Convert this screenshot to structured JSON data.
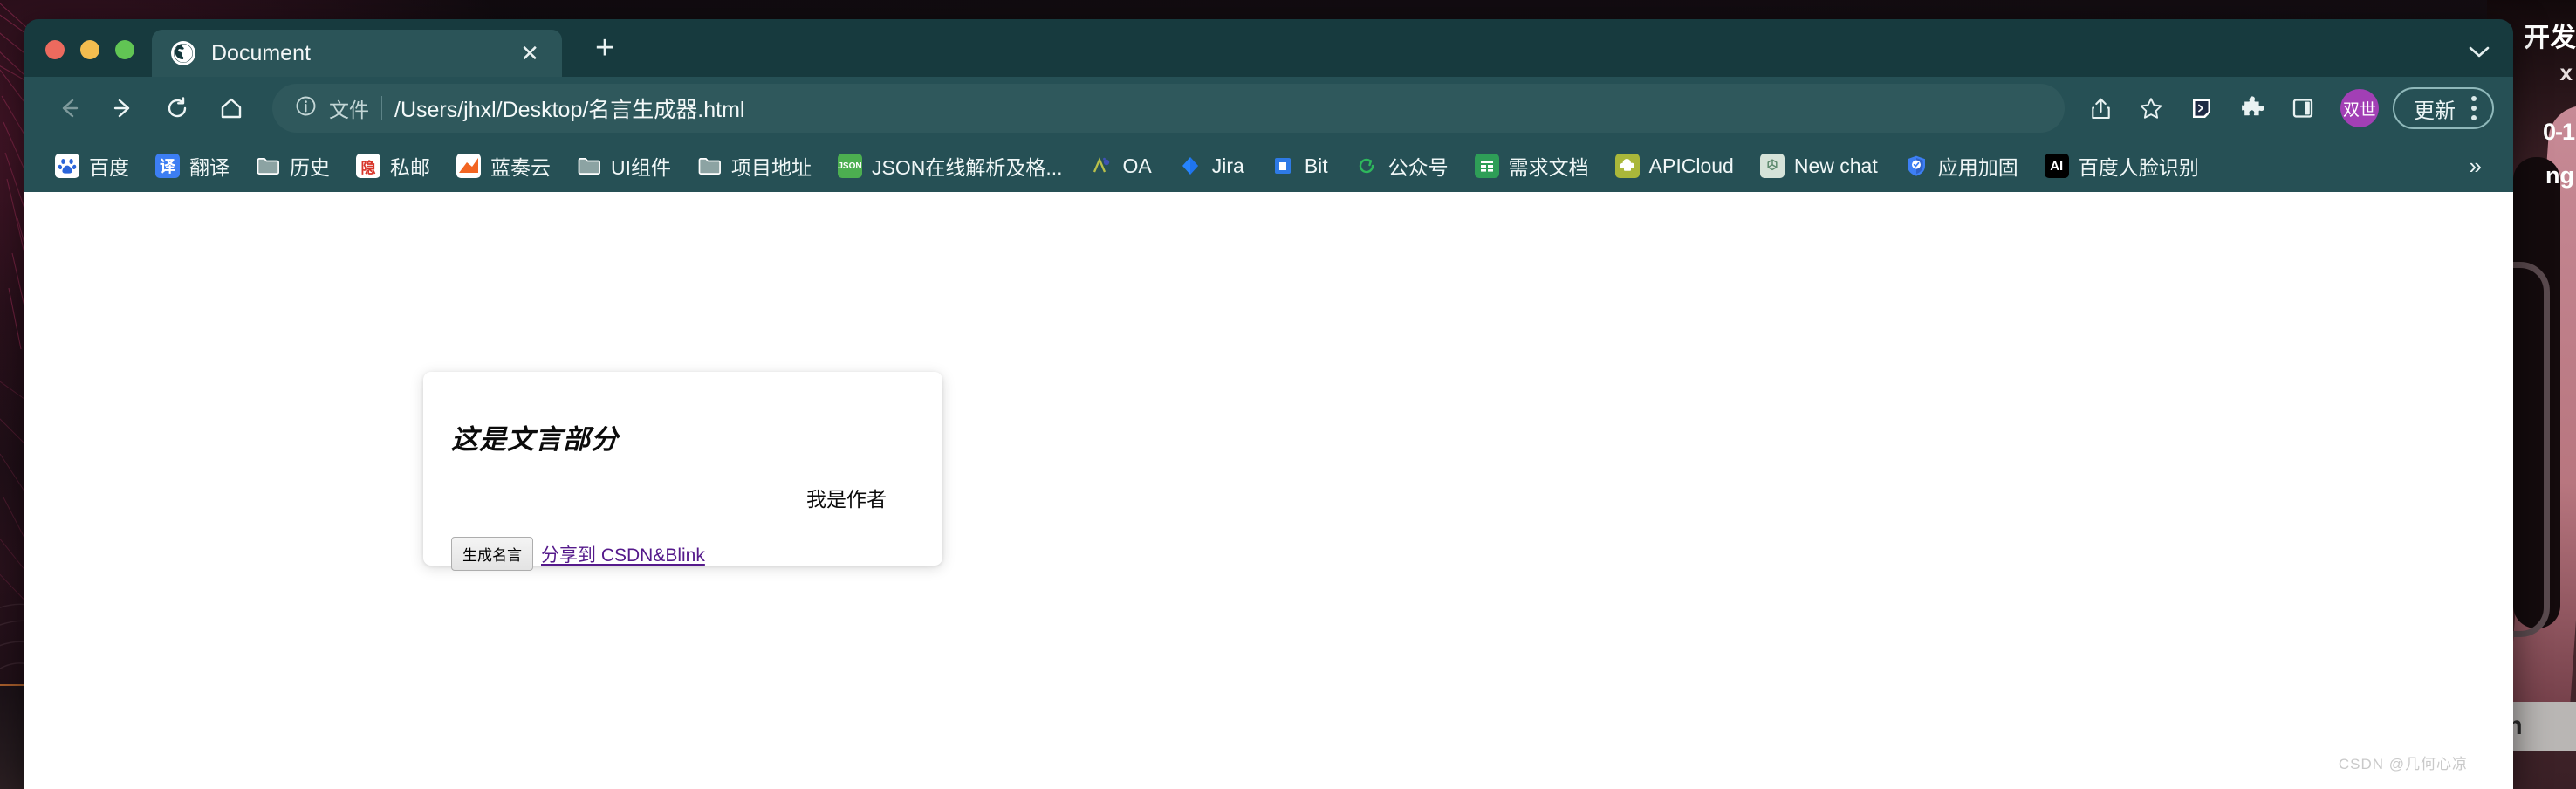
{
  "window": {
    "traffic_lights": [
      "close",
      "minimize",
      "maximize"
    ]
  },
  "tab": {
    "favicon": "globe-icon",
    "title": "Document",
    "close_label": "✕",
    "new_tab_label": "+",
    "tab_search_label": "∨"
  },
  "toolbar": {
    "back_label": "←",
    "forward_label": "→",
    "reload_label": "⟳",
    "home_label": "⌂",
    "omnibox": {
      "info_icon": "info-circle-icon",
      "scheme_label": "文件",
      "url": "/Users/jhxl/Desktop/名言生成器.html"
    },
    "share_label": "share-icon",
    "bookmark_star_label": "star-icon",
    "extension1_label": "devtools-extension-icon",
    "extension_puzzle_label": "puzzle-icon",
    "side_panel_label": "side-panel-icon",
    "avatar_label": "双世",
    "update_label": "更新",
    "menu_label": "kebab-menu-icon"
  },
  "bookmarks": {
    "items": [
      {
        "label": "百度",
        "icon": "baidu-paw-icon",
        "icon_text": "✿",
        "bg": "#ffffff",
        "fg": "#2b65d9"
      },
      {
        "label": "翻译",
        "icon": "translate-icon",
        "icon_text": "译",
        "bg": "#3c7ef3",
        "fg": "#ffffff"
      },
      {
        "label": "历史",
        "icon": "folder-icon",
        "icon_text": "",
        "bg": "folder",
        "fg": "#ffffff"
      },
      {
        "label": "私邮",
        "icon": "private-mail-icon",
        "icon_text": "隐",
        "bg": "#ffffff",
        "fg": "#d8352a"
      },
      {
        "label": "蓝奏云",
        "icon": "lanzou-cloud-icon",
        "icon_text": "◥",
        "bg": "#f26522",
        "fg": "#ffffff"
      },
      {
        "label": "UI组件",
        "icon": "folder-icon",
        "icon_text": "",
        "bg": "folder",
        "fg": "#ffffff"
      },
      {
        "label": "项目地址",
        "icon": "folder-icon",
        "icon_text": "",
        "bg": "folder",
        "fg": "#ffffff"
      },
      {
        "label": "JSON在线解析及格...",
        "icon": "json-icon",
        "icon_text": "{}",
        "bg": "#4caf50",
        "fg": "#ffffff"
      },
      {
        "label": "OA",
        "icon": "oa-icon",
        "icon_text": "A",
        "bg": "#d6d99a",
        "fg": "#3f51b5"
      },
      {
        "label": "Jira",
        "icon": "jira-icon",
        "icon_text": "◆",
        "bg": "transparent",
        "fg": "#2684ff"
      },
      {
        "label": "Bit",
        "icon": "bit-icon",
        "icon_text": "■",
        "bg": "#2e7ae6",
        "fg": "#ffffff"
      },
      {
        "label": "公众号",
        "icon": "wechat-official-icon",
        "icon_text": "⟳",
        "bg": "transparent",
        "fg": "#2eb85c"
      },
      {
        "label": "需求文档",
        "icon": "sheets-icon",
        "icon_text": "≡",
        "bg": "#2e9e57",
        "fg": "#ffffff"
      },
      {
        "label": "APICloud",
        "icon": "apicloud-icon",
        "icon_text": "☁",
        "bg": "#aab73a",
        "fg": "#ffffff"
      },
      {
        "label": "New chat",
        "icon": "openai-icon",
        "icon_text": "◎",
        "bg": "#d6e3d9",
        "fg": "#4a7a5d"
      },
      {
        "label": "应用加固",
        "icon": "shield-check-icon",
        "icon_text": "✓",
        "bg": "#3d7ff5",
        "fg": "#ffffff"
      },
      {
        "label": "百度人脸识别",
        "icon": "ai-icon",
        "icon_text": "AI",
        "bg": "#000000",
        "fg": "#ffffff"
      }
    ],
    "overflow_label": "»"
  },
  "page": {
    "card": {
      "quote": "这是文言部分",
      "author": "我是作者",
      "generate_button": "生成名言",
      "share_link": "分享到 CSDN&Blink"
    },
    "watermark": "CSDN @几何心凉"
  },
  "desktop": {
    "right_text_1": "0-1",
    "right_text_2": "ng",
    "right_text_3": "开发",
    "right_text_4": "x",
    "right_text_5": "tm"
  },
  "colors": {
    "tabstrip": "#173a3e",
    "active_tab": "#2b5458",
    "toolbar": "#265055",
    "omnibox": "#2f585c",
    "avatar": "#a23fb5",
    "link_visited": "#551a8b"
  }
}
